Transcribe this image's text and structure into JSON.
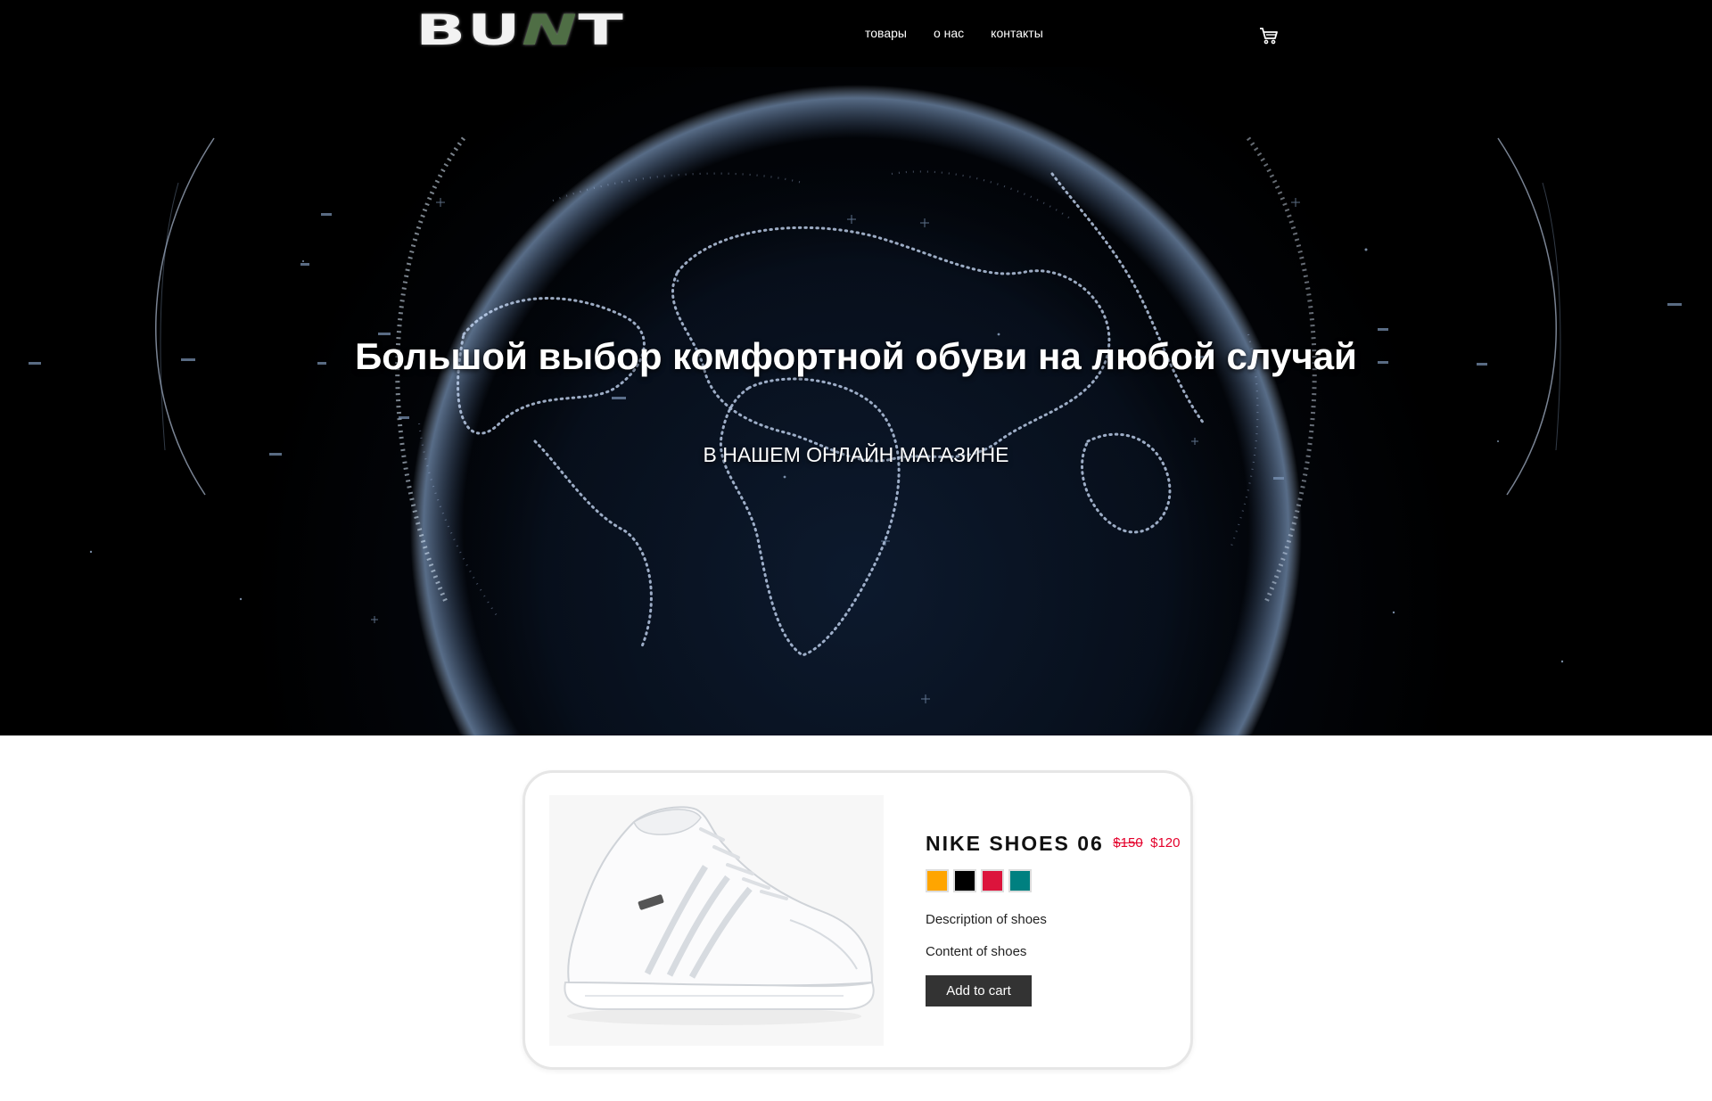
{
  "header": {
    "logo_parts": [
      "BU",
      "N",
      "T"
    ],
    "nav": [
      "товары",
      "о нас",
      "контакты"
    ],
    "cart_icon": "cart-icon"
  },
  "hero": {
    "title": "Большой выбор комфортной обуви на любой случай",
    "subtitle": "В НАШЕМ ОНЛАЙН МАГАЗИНЕ"
  },
  "product": {
    "name": "NIKE SHOES 06",
    "old_price": "$150",
    "new_price": "$120",
    "colors": [
      "#ffa500",
      "#000000",
      "#dc143c",
      "#008080"
    ],
    "description": "Description of shoes",
    "content": "Content of shoes",
    "add_to_cart": "Add to cart"
  },
  "colors": {
    "accent_price": "#e4002b",
    "logo_accent": "#4f6e45",
    "button_bg": "#333333"
  }
}
